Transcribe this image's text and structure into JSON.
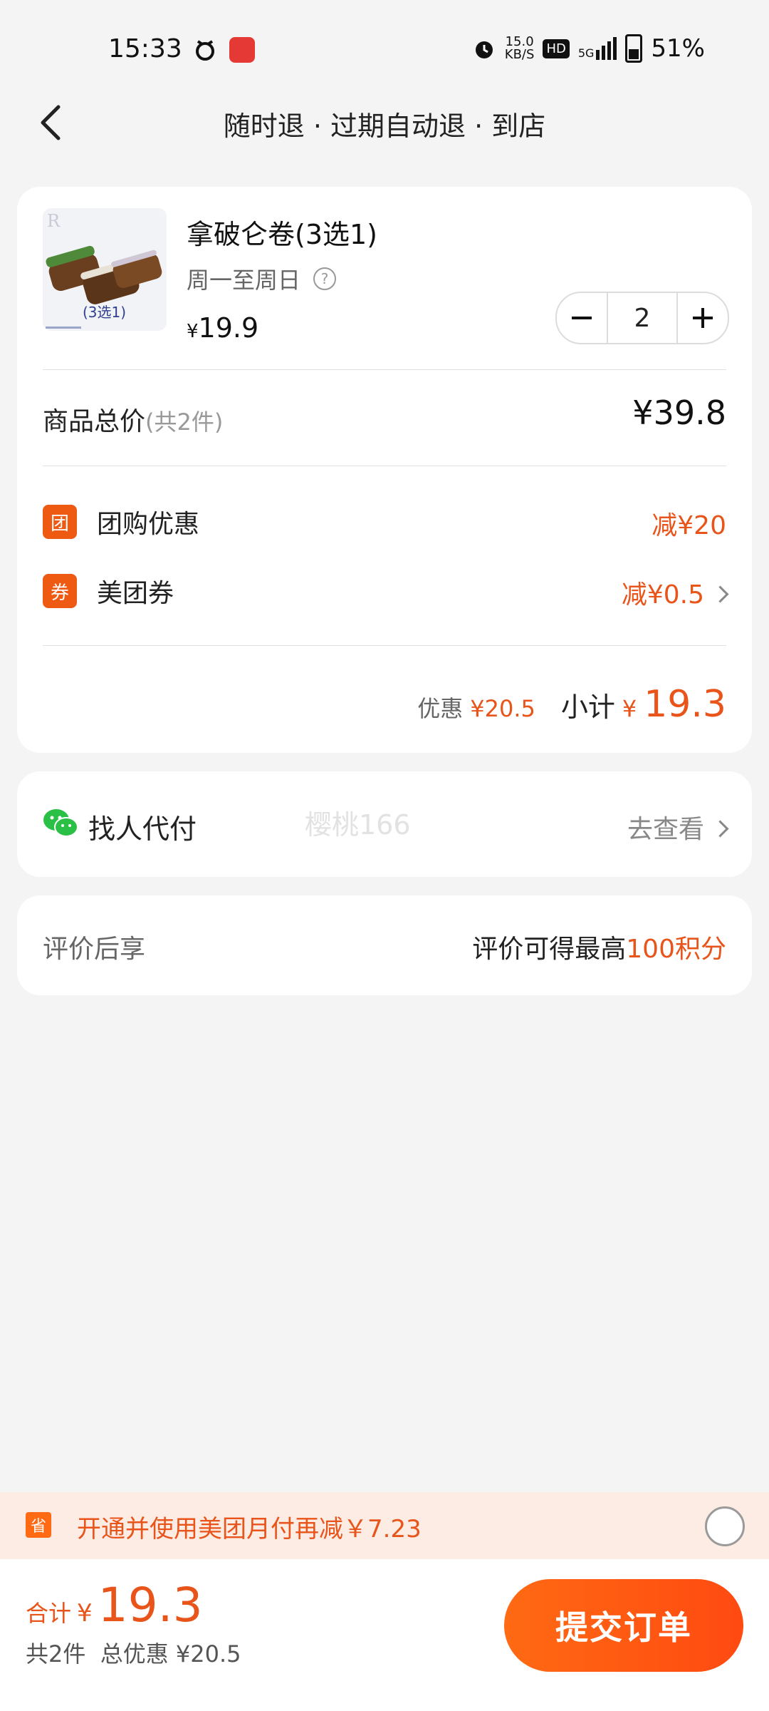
{
  "status_bar": {
    "time": "15:33",
    "net_speed": "15.0",
    "net_unit": "KB/S",
    "hd": "HD",
    "network": "5G",
    "battery": "51%"
  },
  "header": {
    "title": "随时退 · 过期自动退 · 到店"
  },
  "product": {
    "name": "拿破仑卷(3选1)",
    "availability": "周一至周日",
    "currency": "¥",
    "price": "19.9",
    "quantity": "2",
    "thumb_text": "(3选1)"
  },
  "total": {
    "label": "商品总价",
    "count": "(共2件)",
    "value": "¥39.8"
  },
  "discounts": [
    {
      "badge": "团",
      "label": "团购优惠",
      "value": "减¥20"
    },
    {
      "badge": "券",
      "label": "美团券",
      "value": "减¥0.5"
    }
  ],
  "subtotal": {
    "discount_label": "优惠",
    "discount_value": "¥20.5",
    "label": "小计",
    "currency": "¥",
    "value": "19.3"
  },
  "pay_for_me": {
    "label": "找人代付",
    "watermark": "樱桃166",
    "action": "去查看"
  },
  "review": {
    "label": "评价后享",
    "text": "评价可得最高",
    "points": "100积分"
  },
  "banner": {
    "icon": "省",
    "text": "开通并使用美团月付再减￥7.23"
  },
  "bottom": {
    "total_label": "合计",
    "currency": "¥",
    "total_value": "19.3",
    "summary": "共2件  总优惠 ¥20.5",
    "submit": "提交订单"
  },
  "colors": {
    "accent": "#e8541a",
    "button": "#ff5a12",
    "wechat": "#2ac045"
  }
}
